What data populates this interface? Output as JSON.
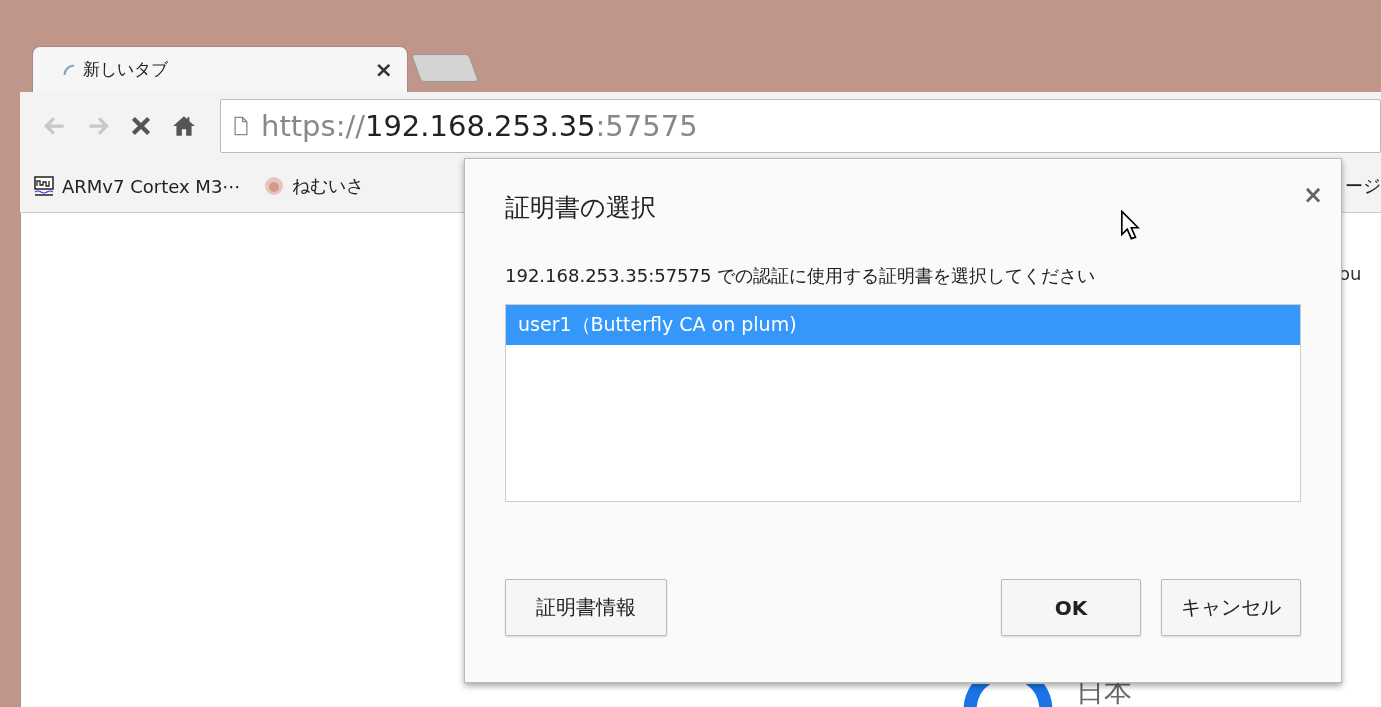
{
  "tabs": [
    {
      "title": "新しいタブ",
      "selected": true,
      "loading": true,
      "close": "×"
    }
  ],
  "toolbar": {
    "buttons": [
      {
        "kind": "back",
        "disabled": true
      },
      {
        "kind": "forward",
        "disabled": true
      },
      {
        "kind": "stop",
        "disabled": false
      },
      {
        "kind": "home",
        "disabled": false
      }
    ]
  },
  "address": {
    "scheme": "https://",
    "host": "192.168.253.35",
    "port": ":57575"
  },
  "bookmarks": [
    {
      "label": "ARMv7 Cortex M3⋯",
      "kind": "chart"
    },
    {
      "label": "ねむいさ",
      "kind": "face"
    },
    {
      "label": "ージ",
      "kind": "none"
    }
  ],
  "page": {
    "side_text": "ou",
    "footer_text": "日本"
  },
  "dialog": {
    "title": "証明書の選択",
    "close": "×",
    "message": "192.168.253.35:57575 での認証に使用する証明書を選択してください",
    "certificates": [
      {
        "label": "user1（Butterfly CA on plum)",
        "selected": true
      }
    ],
    "buttons": [
      {
        "label": "証明書情報",
        "kind": "info"
      },
      {
        "label": "OK",
        "kind": "default"
      },
      {
        "label": "キャンセル",
        "kind": "cancel"
      }
    ]
  }
}
